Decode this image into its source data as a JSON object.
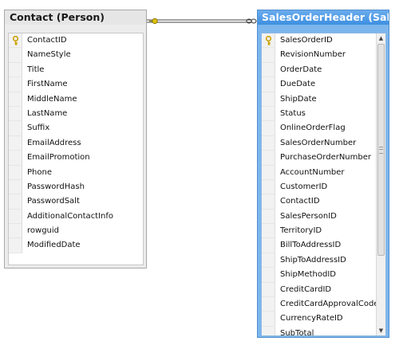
{
  "contact_table": {
    "title": "Contact (Person)",
    "primary_key": "ContactID",
    "columns": [
      "ContactID",
      "NameStyle",
      "Title",
      "FirstName",
      "MiddleName",
      "LastName",
      "Suffix",
      "EmailAddress",
      "EmailPromotion",
      "Phone",
      "PasswordHash",
      "PasswordSalt",
      "AdditionalContactInfo",
      "rowguid",
      "ModifiedDate"
    ]
  },
  "sales_order_header_table": {
    "title": "SalesOrderHeader (Sales)",
    "primary_key": "SalesOrderID",
    "columns": [
      "SalesOrderID",
      "RevisionNumber",
      "OrderDate",
      "DueDate",
      "ShipDate",
      "Status",
      "OnlineOrderFlag",
      "SalesOrderNumber",
      "PurchaseOrderNumber",
      "AccountNumber",
      "CustomerID",
      "ContactID",
      "SalesPersonID",
      "TerritoryID",
      "BillToAddressID",
      "ShipToAddressID",
      "ShipMethodID",
      "CreditCardID",
      "CreditCardApprovalCode",
      "CurrencyRateID",
      "SubTotal"
    ]
  },
  "colors": {
    "active_title": "#3d8fe0",
    "inactive_title": "#e6e6e6",
    "key_icon": "#e0b800"
  },
  "icons": {
    "key": "primary-key-icon",
    "one_end": "relationship-key-end-icon",
    "many_end": "relationship-infinity-end-icon"
  }
}
